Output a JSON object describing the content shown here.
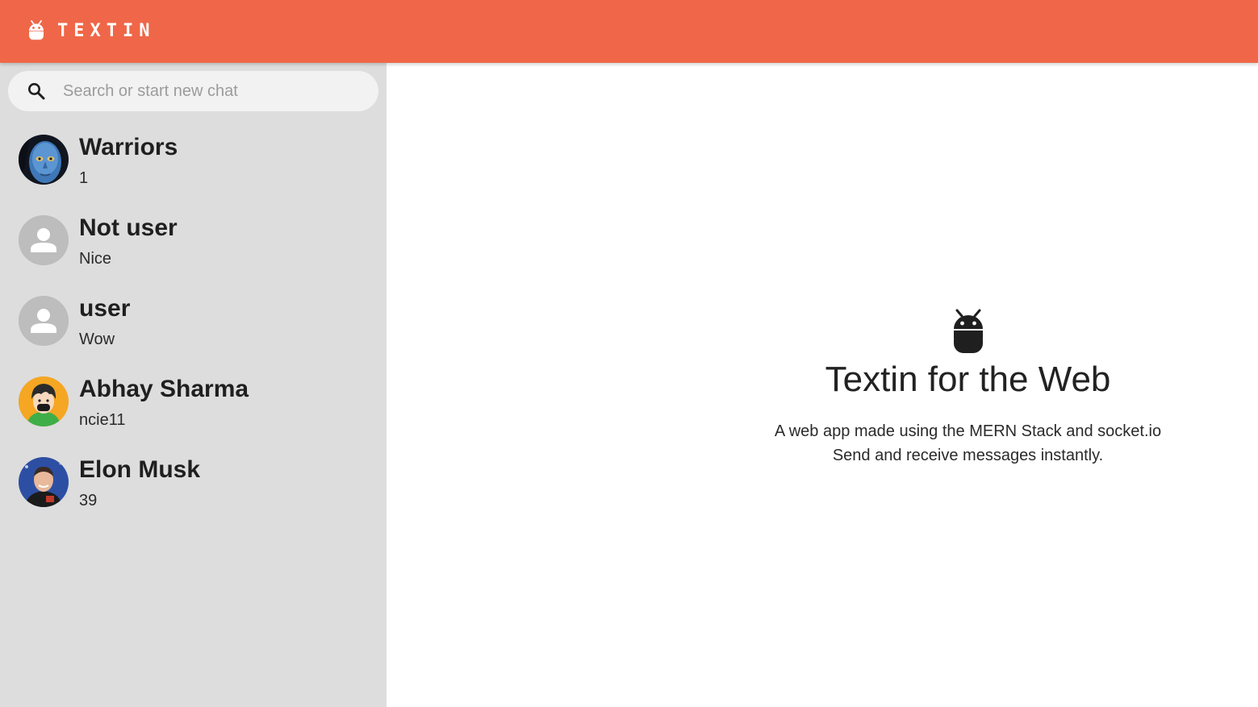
{
  "header": {
    "brand_name": "TEXTIN",
    "brand_icon": "android-icon",
    "background_color": "#ef6748"
  },
  "search": {
    "placeholder": "Search or start new chat",
    "icon": "search-icon"
  },
  "chats": [
    {
      "name": "Warriors",
      "last_message": "1",
      "avatar": "avatar-image-blue-face"
    },
    {
      "name": "Not user",
      "last_message": "Nice",
      "avatar": "default-person-icon"
    },
    {
      "name": "user",
      "last_message": "Wow",
      "avatar": "default-person-icon"
    },
    {
      "name": "Abhay Sharma",
      "last_message": "ncie11",
      "avatar": "avatar-image-cartoon-boy"
    },
    {
      "name": "Elon Musk",
      "last_message": "39",
      "avatar": "avatar-image-photo"
    }
  ],
  "welcome": {
    "icon": "android-icon",
    "title": "Textin for the Web",
    "line1": "A web app made using the MERN Stack and socket.io",
    "line2": "Send and receive messages instantly."
  },
  "colors": {
    "accent": "#ef6748",
    "sidebar_bg": "#dddddd",
    "search_bg": "#f2f2f2"
  }
}
